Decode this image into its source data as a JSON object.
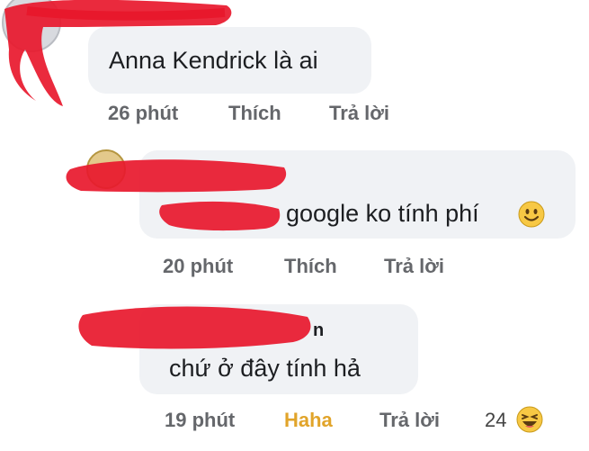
{
  "comments": [
    {
      "text": "Anna Kendrick là ai",
      "meta": {
        "time": "26 phút",
        "like": "Thích",
        "reply": "Trả lời"
      }
    },
    {
      "text": "google ko tính phí",
      "emoji": "slightly-smiling-face-icon",
      "meta": {
        "time": "20 phút",
        "like": "Thích",
        "reply": "Trả lời"
      }
    },
    {
      "name_fragment": "n",
      "text": "chứ ở đây tính hả",
      "meta": {
        "time": "19 phút",
        "reaction": "Haha",
        "reply": "Trả lời",
        "reaction_count": "24"
      },
      "reaction_emoji": "laughing-face-icon"
    }
  ],
  "colors": {
    "bubble": "#f0f2f5",
    "redaction": "#e8182c",
    "haha": "#e1a42a",
    "meta": "#65676b"
  }
}
